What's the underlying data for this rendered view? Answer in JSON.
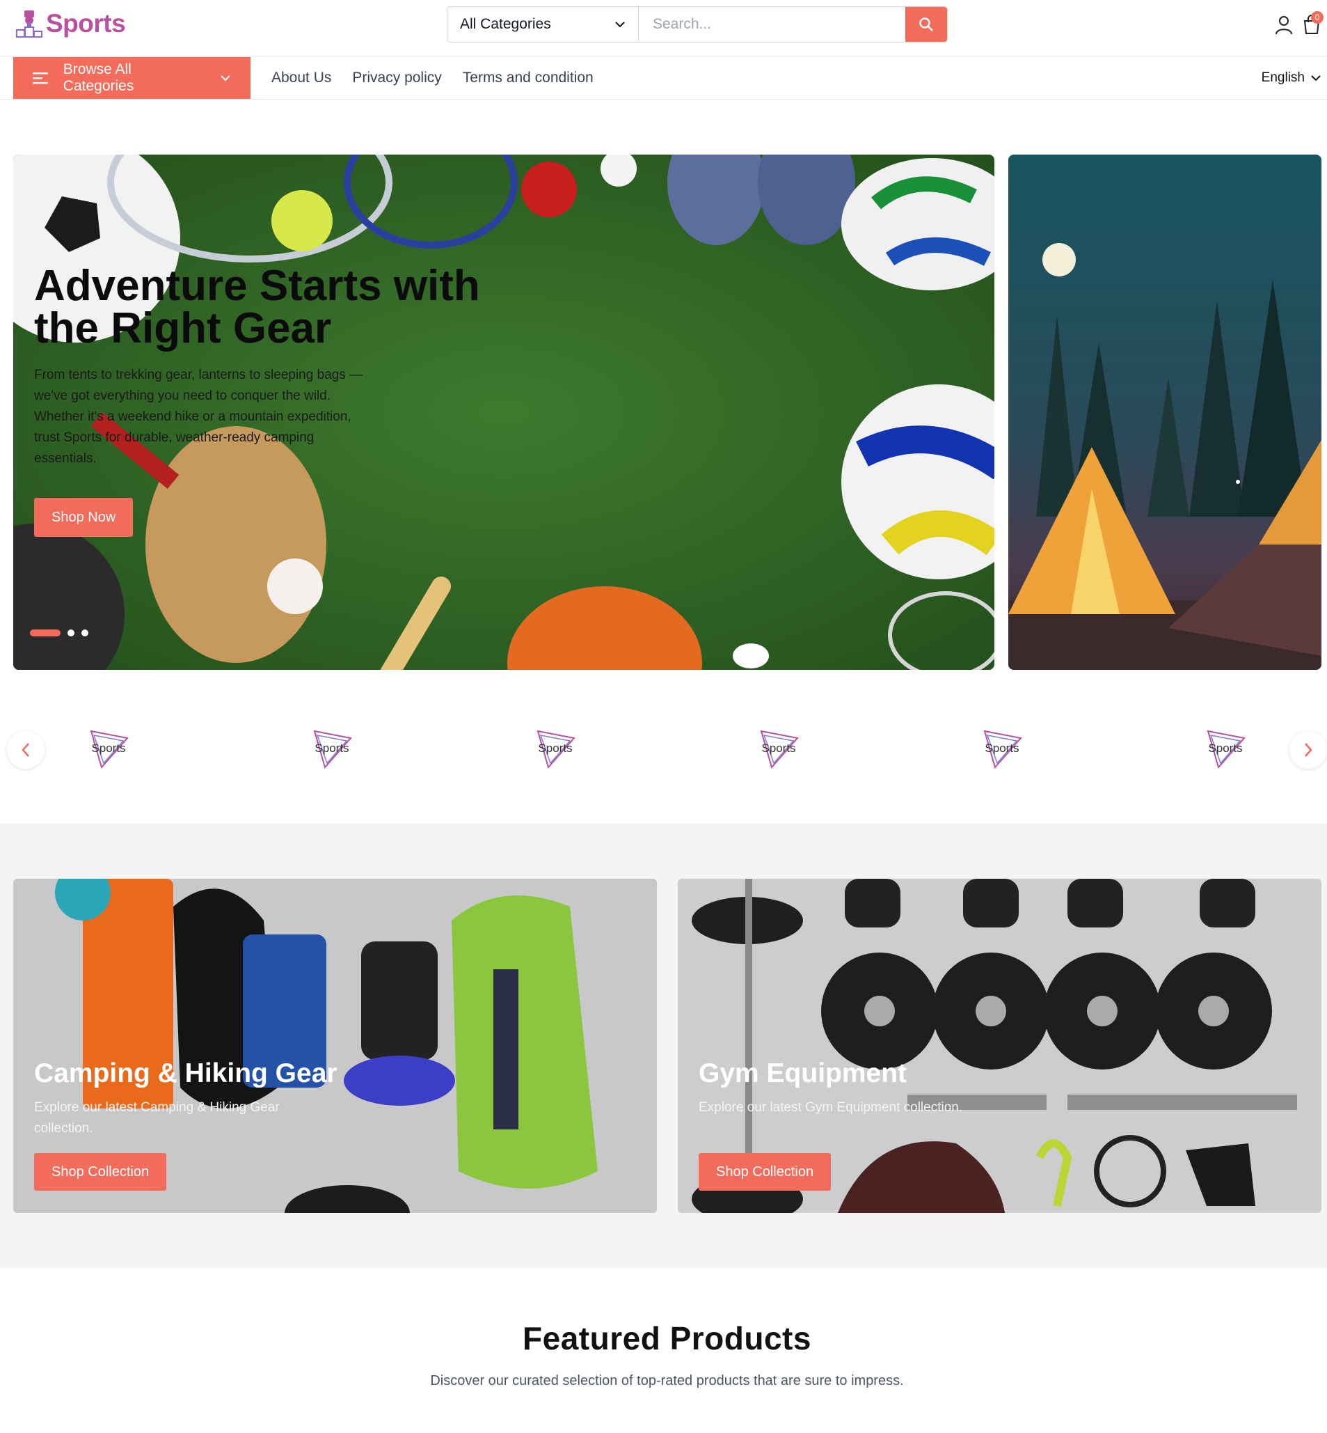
{
  "header": {
    "logo_text": "Sports",
    "category_select": "All Categories",
    "search_placeholder": "Search...",
    "cart_count": "0"
  },
  "nav": {
    "browse_label": "Browse All Categories",
    "links": [
      "About Us",
      "Privacy policy",
      "Terms and condition"
    ],
    "language": "English"
  },
  "hero": {
    "title": "Adventure Starts with the Right Gear",
    "description": "From tents to trekking gear, lanterns to sleeping bags — we've got everything you need to conquer the wild. Whether it's a weekend hike or a mountain expedition, trust Sports for durable, weather-ready camping essentials.",
    "button": "Shop Now",
    "slide_count": 3,
    "active_slide": 1
  },
  "brands": {
    "logo_text": "Sports",
    "count": 6
  },
  "collections": [
    {
      "title": "Camping & Hiking Gear",
      "description": "Explore our latest Camping & Hiking Gear collection.",
      "button": "Shop Collection"
    },
    {
      "title": "Gym Equipment",
      "description": "Explore our latest Gym Equipment collection.",
      "button": "Shop Collection"
    }
  ],
  "featured": {
    "title": "Featured Products",
    "subtitle": "Discover our curated selection of top-rated products that are sure to impress."
  },
  "colors": {
    "accent": "#f26b5b",
    "brand": "#b8519e",
    "section_bg": "#f3f4f6"
  },
  "icons": [
    "trophy-logo-icon",
    "chevron-down-icon",
    "search-icon",
    "user-icon",
    "cart-icon",
    "menu-icon",
    "chevron-left-icon",
    "chevron-right-icon"
  ]
}
